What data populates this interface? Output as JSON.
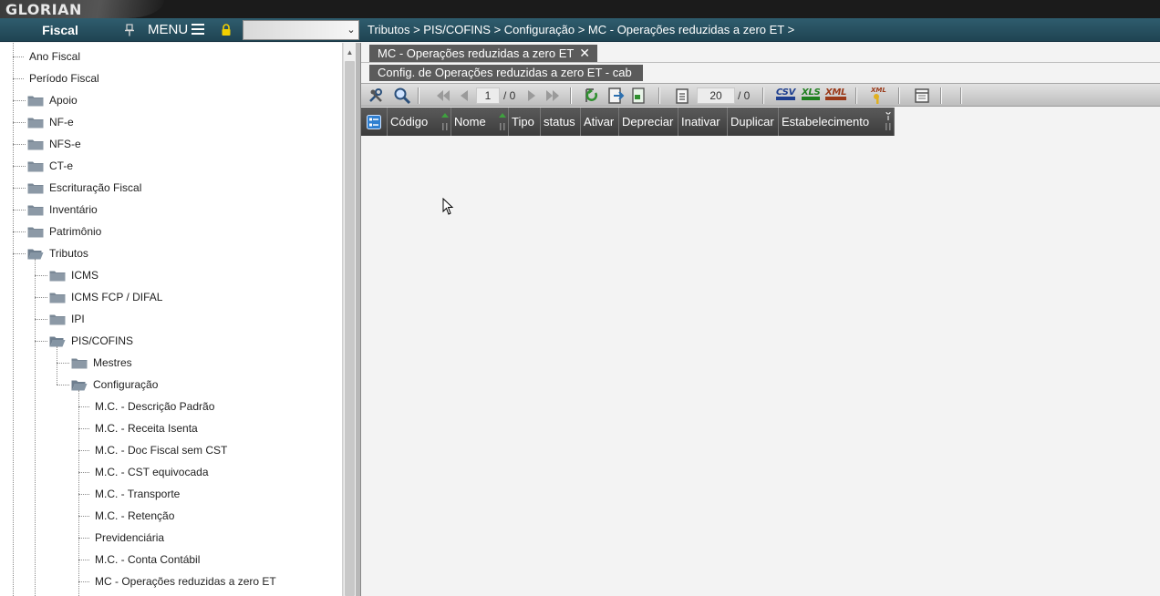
{
  "app": {
    "logo": "GLORIAN",
    "module": "Fiscal",
    "menu_label": "MENU"
  },
  "breadcrumb": "Tributos > PIS/COFINS > Configuração > MC - Operações reduzidas a zero ET >",
  "tree": [
    {
      "label": "Ano Fiscal",
      "folder": false
    },
    {
      "label": "Período Fiscal",
      "folder": false
    },
    {
      "label": "Apoio",
      "folder": true
    },
    {
      "label": "NF-e",
      "folder": true
    },
    {
      "label": "NFS-e",
      "folder": true
    },
    {
      "label": "CT-e",
      "folder": true
    },
    {
      "label": "Escrituração Fiscal",
      "folder": true
    },
    {
      "label": "Inventário",
      "folder": true
    },
    {
      "label": "Patrimônio",
      "folder": true
    },
    {
      "label": "Tributos",
      "folder": true,
      "open": true
    },
    {
      "label": "ICMS",
      "folder": true
    },
    {
      "label": "ICMS FCP / DIFAL",
      "folder": true
    },
    {
      "label": "IPI",
      "folder": true
    },
    {
      "label": "PIS/COFINS",
      "folder": true,
      "open": true
    },
    {
      "label": "Mestres",
      "folder": true
    },
    {
      "label": "Configuração",
      "folder": true,
      "open": true
    },
    {
      "label": "M.C. - Descrição Padrão",
      "folder": false
    },
    {
      "label": "M.C. - Receita Isenta",
      "folder": false
    },
    {
      "label": "M.C. - Doc Fiscal sem CST",
      "folder": false
    },
    {
      "label": "M.C. - CST equivocada",
      "folder": false
    },
    {
      "label": "M.C. - Transporte",
      "folder": false
    },
    {
      "label": "M.C. - Retenção",
      "folder": false
    },
    {
      "label": "Previdenciária",
      "folder": false
    },
    {
      "label": "M.C. - Conta Contábil",
      "folder": false
    },
    {
      "label": "MC - Operações reduzidas a zero ET",
      "folder": false
    }
  ],
  "tabs": {
    "main": "MC - Operações reduzidas a zero ET",
    "close": "✕",
    "sub": "Config. de Operações reduzidas a zero ET - cab"
  },
  "toolbar": {
    "page_current": "1",
    "page_total": "/ 0",
    "page_size": "20",
    "record_total": "/ 0",
    "csv": "CSV",
    "xls": "XLS",
    "xml": "XML",
    "xml_small": "XML"
  },
  "columns": [
    "Código",
    "Nome",
    "Tipo",
    "status",
    "Ativar",
    "Depreciar",
    "Inativar",
    "Duplicar",
    "Estabelecimento"
  ],
  "colors": {
    "header": "#1f4452",
    "grid_header": "#444444",
    "tab": "#5b5b5b"
  }
}
